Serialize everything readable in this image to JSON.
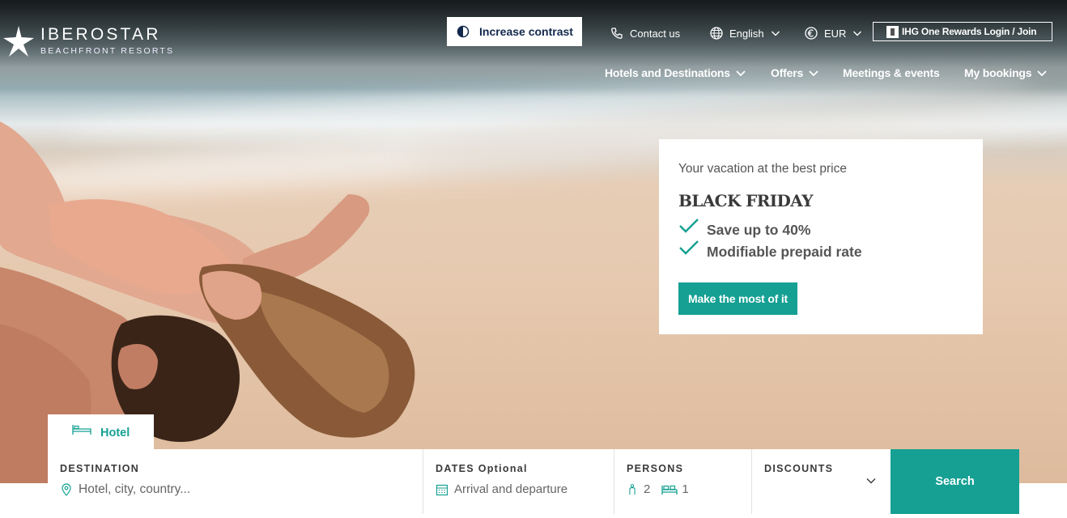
{
  "brand": {
    "name": "IBEROSTAR",
    "tagline": "BEACHFRONT RESORTS"
  },
  "header": {
    "contrast_label": "Increase contrast",
    "contact_label": "Contact us",
    "language": "English",
    "currency": "EUR",
    "rewards_label": "IHG One Rewards Login / Join"
  },
  "nav": {
    "items": [
      {
        "label": "Hotels and Destinations",
        "has_dropdown": true
      },
      {
        "label": "Offers",
        "has_dropdown": true
      },
      {
        "label": "Meetings & events",
        "has_dropdown": false
      },
      {
        "label": "My bookings",
        "has_dropdown": true
      }
    ]
  },
  "promo": {
    "eyebrow": "Your vacation at the best price",
    "headline": "BLACK FRIDAY",
    "benefits": [
      "Save up to 40%",
      "Modifiable prepaid rate"
    ],
    "cta_label": "Make the most of it"
  },
  "booking": {
    "tab_label": "Hotel",
    "destination": {
      "label": "DESTINATION",
      "placeholder": "Hotel, city, country..."
    },
    "dates": {
      "label": "DATES Optional",
      "placeholder": "Arrival and departure"
    },
    "persons": {
      "label": "PERSONS",
      "adults": "2",
      "rooms": "1"
    },
    "discounts": {
      "label": "DISCOUNTS"
    },
    "search_label": "Search"
  },
  "colors": {
    "accent": "#15a093",
    "contrast_text": "#12284c",
    "text_dark": "#3a3a3a"
  },
  "icons": [
    "star-logo-icon",
    "contrast-icon",
    "phone-icon",
    "globe-icon",
    "euro-icon",
    "chevron-down-icon",
    "check-icon",
    "bed-icon",
    "location-pin-icon",
    "calendar-icon",
    "person-icon",
    "room-icon"
  ]
}
